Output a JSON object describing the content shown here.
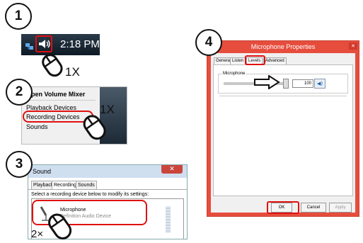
{
  "steps": {
    "one": "1",
    "two": "2",
    "three": "3",
    "four": "4"
  },
  "panel1": {
    "time": "2:18 PM",
    "clicks": "1X"
  },
  "panel2": {
    "menu": [
      "Open Volume Mixer",
      "Playback Devices",
      "Recording Devices",
      "Sounds"
    ],
    "clicks": "1X"
  },
  "panel3": {
    "title": "Sound",
    "tabs": [
      "Playback",
      "Recording",
      "Sounds"
    ],
    "description": "Select a recording device below to modify its settings:",
    "device_name": "Microphone",
    "device_sub": "Definition Audio Device",
    "clicks": "2×"
  },
  "panel4": {
    "title": "Microphone Properties",
    "tabs": [
      "General",
      "Listen",
      "Levels",
      "Advanced"
    ],
    "group_label": "Microphone",
    "volume": "100",
    "buttons": [
      "OK",
      "Cancel",
      "Apply"
    ]
  },
  "colors": {
    "highlight": "#e01010",
    "dialog_red": "#e64d3d"
  }
}
